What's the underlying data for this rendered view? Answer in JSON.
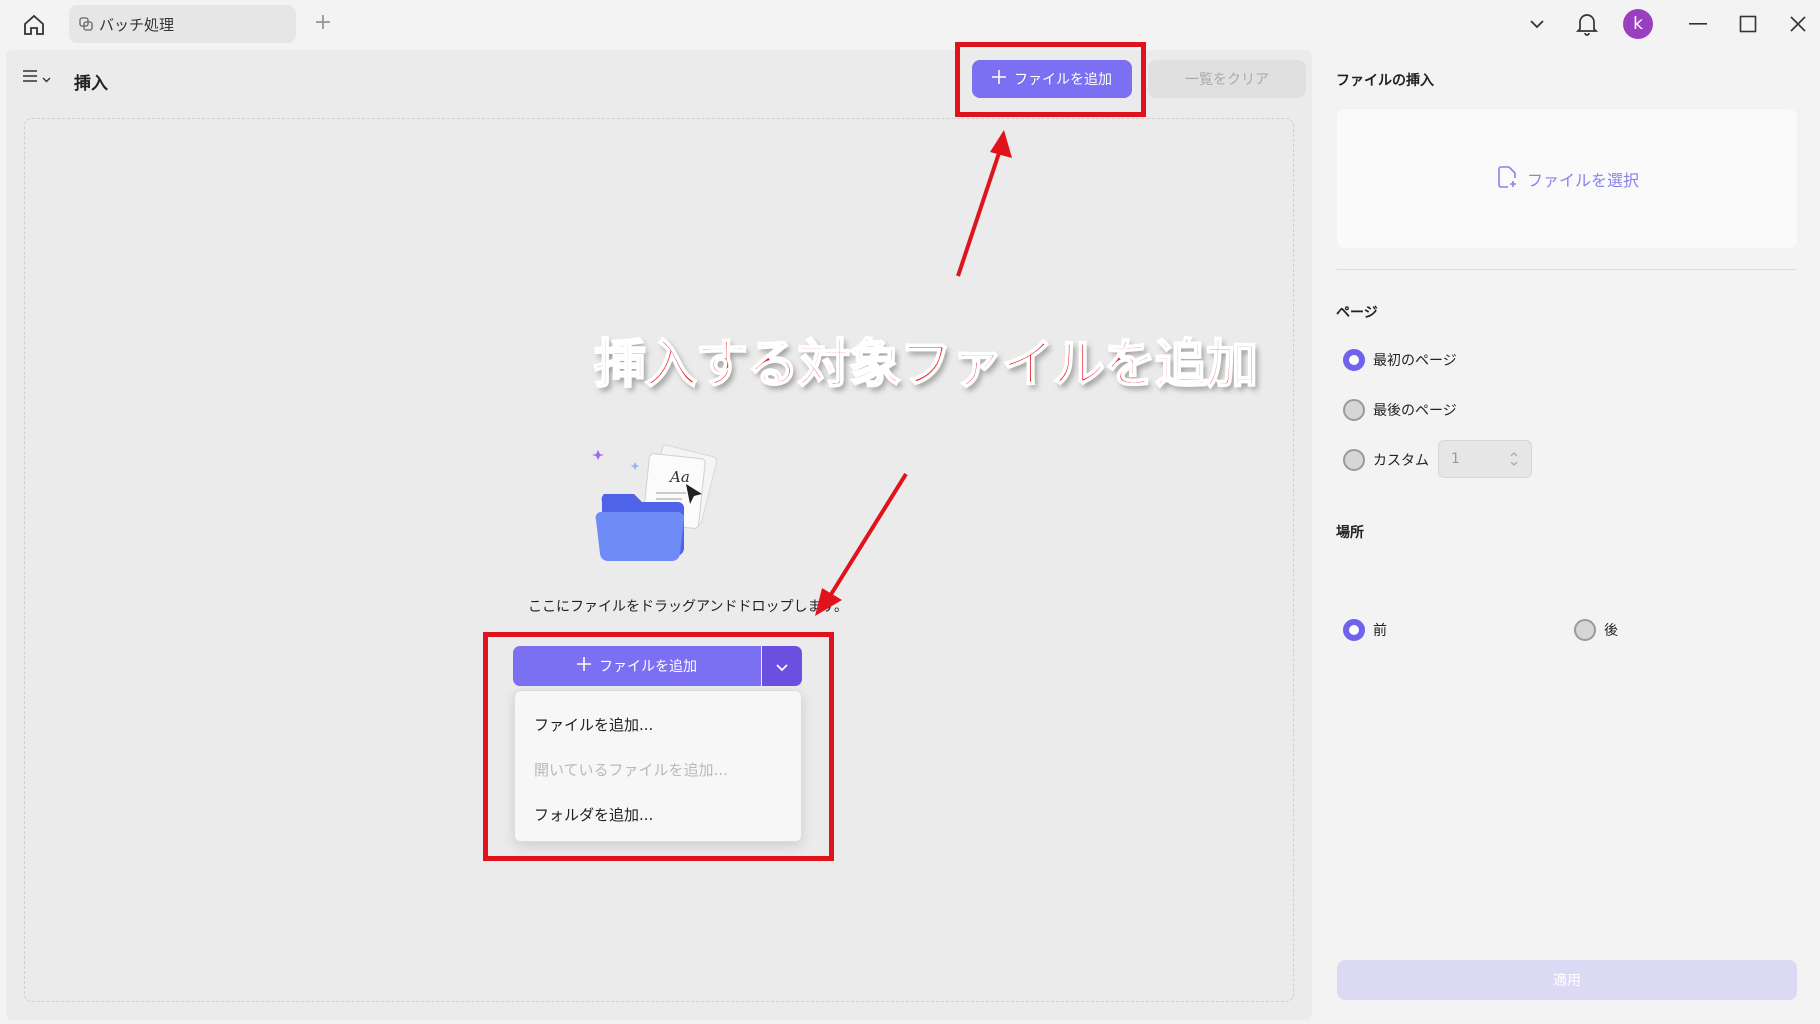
{
  "titlebar": {
    "tab_label": "バッチ処理",
    "new_tab": "+",
    "avatar_letter": "k"
  },
  "main": {
    "title": "挿入",
    "add_file": "ファイルを追加",
    "clear_list": "一覧をクリア",
    "drop_hint": "ここにファイルをドラッグアンドドロップします。",
    "illustration_text": "Aa",
    "dropdown": {
      "items": [
        {
          "label": "ファイルを追加...",
          "enabled": true
        },
        {
          "label": "開いているファイルを追加...",
          "enabled": false
        },
        {
          "label": "フォルダを追加...",
          "enabled": true
        }
      ]
    }
  },
  "annotation": {
    "callout": "挿入する対象ファイルを追加"
  },
  "side": {
    "title": "ファイルの挿入",
    "select_file": "ファイルを選択",
    "page_label": "ページ",
    "page_options": [
      {
        "label": "最初のページ",
        "selected": true
      },
      {
        "label": "最後のページ",
        "selected": false
      },
      {
        "label": "カスタム",
        "selected": false
      }
    ],
    "custom_value": "1",
    "location_label": "場所",
    "location_options": [
      {
        "label": "前",
        "selected": true
      },
      {
        "label": "後",
        "selected": false
      }
    ],
    "apply": "適用"
  },
  "colors": {
    "accent": "#7b6ff2",
    "annotation_red": "#e0121b",
    "avatar": "#9b3fc1"
  }
}
